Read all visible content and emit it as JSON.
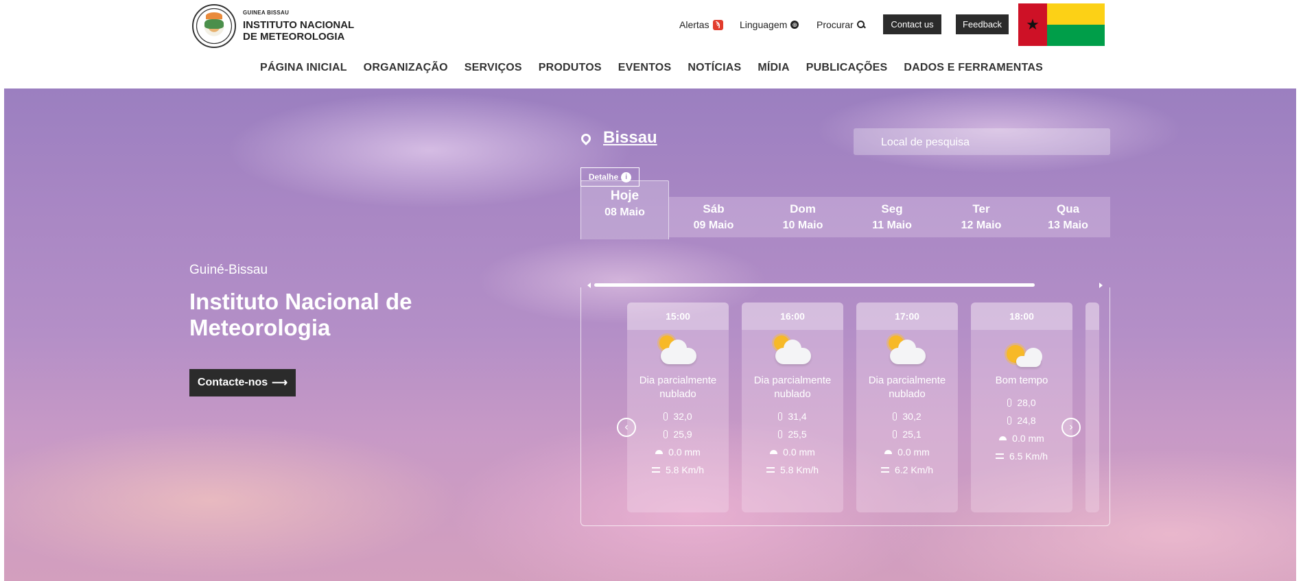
{
  "header": {
    "brand_small": "GUINEA BISSAU",
    "brand_line1": "INSTITUTO NACIONAL",
    "brand_line2": "DE METEOROLOGIA",
    "alerts": "Alertas",
    "language": "Linguagem",
    "search": "Procurar",
    "contact_us": "Contact us",
    "feedback": "Feedback"
  },
  "nav": [
    "PÁGINA INICIAL",
    "ORGANIZAÇÃO",
    "SERVIÇOS",
    "PRODUTOS",
    "EVENTOS",
    "NOTÍCIAS",
    "MÍDIA",
    "PUBLICAÇÕES",
    "DADOS E FERRAMENTAS"
  ],
  "hero": {
    "country": "Guiné-Bissau",
    "title": "Instituto Nacional de Meteorologia",
    "contact_button": "Contacte-nos"
  },
  "weather": {
    "city": "Bissau",
    "search_placeholder": "Local de pesquisa",
    "detail_button": "Detalhe",
    "days": [
      {
        "name": "Hoje",
        "date": "08 Maio"
      },
      {
        "name": "Sáb",
        "date": "09 Maio"
      },
      {
        "name": "Dom",
        "date": "10 Maio"
      },
      {
        "name": "Seg",
        "date": "11 Maio"
      },
      {
        "name": "Ter",
        "date": "12 Maio"
      },
      {
        "name": "Qua",
        "date": "13 Maio"
      }
    ],
    "hours": [
      {
        "time": "15:00",
        "desc_line1": "Dia parcialmente",
        "desc_line2": "nublado",
        "tmax": "32,0",
        "tmin": "25,9",
        "rain": "0.0 mm",
        "wind": "5.8 Km/h"
      },
      {
        "time": "16:00",
        "desc_line1": "Dia parcialmente",
        "desc_line2": "nublado",
        "tmax": "31,4",
        "tmin": "25,5",
        "rain": "0.0 mm",
        "wind": "5.8 Km/h"
      },
      {
        "time": "17:00",
        "desc_line1": "Dia parcialmente",
        "desc_line2": "nublado",
        "tmax": "30,2",
        "tmin": "25,1",
        "rain": "0.0 mm",
        "wind": "6.2 Km/h"
      },
      {
        "time": "18:00",
        "desc_line1": "Bom tempo",
        "desc_line2": "",
        "tmax": "28,0",
        "tmin": "24,8",
        "rain": "0.0 mm",
        "wind": "6.5 Km/h"
      }
    ]
  },
  "colors": {
    "accent_dark": "#2b2b2b",
    "rss": "#e23c2d"
  }
}
